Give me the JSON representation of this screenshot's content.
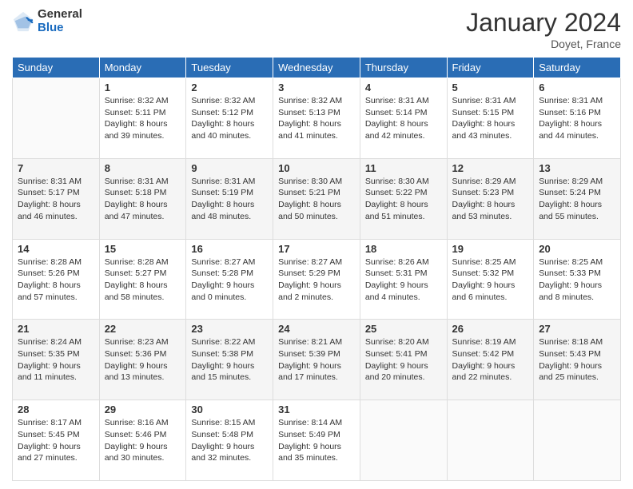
{
  "header": {
    "logo_general": "General",
    "logo_blue": "Blue",
    "month_title": "January 2024",
    "location": "Doyet, France"
  },
  "days_of_week": [
    "Sunday",
    "Monday",
    "Tuesday",
    "Wednesday",
    "Thursday",
    "Friday",
    "Saturday"
  ],
  "weeks": [
    [
      {
        "day": "",
        "sunrise": "",
        "sunset": "",
        "daylight": ""
      },
      {
        "day": "1",
        "sunrise": "Sunrise: 8:32 AM",
        "sunset": "Sunset: 5:11 PM",
        "daylight": "Daylight: 8 hours and 39 minutes."
      },
      {
        "day": "2",
        "sunrise": "Sunrise: 8:32 AM",
        "sunset": "Sunset: 5:12 PM",
        "daylight": "Daylight: 8 hours and 40 minutes."
      },
      {
        "day": "3",
        "sunrise": "Sunrise: 8:32 AM",
        "sunset": "Sunset: 5:13 PM",
        "daylight": "Daylight: 8 hours and 41 minutes."
      },
      {
        "day": "4",
        "sunrise": "Sunrise: 8:31 AM",
        "sunset": "Sunset: 5:14 PM",
        "daylight": "Daylight: 8 hours and 42 minutes."
      },
      {
        "day": "5",
        "sunrise": "Sunrise: 8:31 AM",
        "sunset": "Sunset: 5:15 PM",
        "daylight": "Daylight: 8 hours and 43 minutes."
      },
      {
        "day": "6",
        "sunrise": "Sunrise: 8:31 AM",
        "sunset": "Sunset: 5:16 PM",
        "daylight": "Daylight: 8 hours and 44 minutes."
      }
    ],
    [
      {
        "day": "7",
        "sunrise": "Sunrise: 8:31 AM",
        "sunset": "Sunset: 5:17 PM",
        "daylight": "Daylight: 8 hours and 46 minutes."
      },
      {
        "day": "8",
        "sunrise": "Sunrise: 8:31 AM",
        "sunset": "Sunset: 5:18 PM",
        "daylight": "Daylight: 8 hours and 47 minutes."
      },
      {
        "day": "9",
        "sunrise": "Sunrise: 8:31 AM",
        "sunset": "Sunset: 5:19 PM",
        "daylight": "Daylight: 8 hours and 48 minutes."
      },
      {
        "day": "10",
        "sunrise": "Sunrise: 8:30 AM",
        "sunset": "Sunset: 5:21 PM",
        "daylight": "Daylight: 8 hours and 50 minutes."
      },
      {
        "day": "11",
        "sunrise": "Sunrise: 8:30 AM",
        "sunset": "Sunset: 5:22 PM",
        "daylight": "Daylight: 8 hours and 51 minutes."
      },
      {
        "day": "12",
        "sunrise": "Sunrise: 8:29 AM",
        "sunset": "Sunset: 5:23 PM",
        "daylight": "Daylight: 8 hours and 53 minutes."
      },
      {
        "day": "13",
        "sunrise": "Sunrise: 8:29 AM",
        "sunset": "Sunset: 5:24 PM",
        "daylight": "Daylight: 8 hours and 55 minutes."
      }
    ],
    [
      {
        "day": "14",
        "sunrise": "Sunrise: 8:28 AM",
        "sunset": "Sunset: 5:26 PM",
        "daylight": "Daylight: 8 hours and 57 minutes."
      },
      {
        "day": "15",
        "sunrise": "Sunrise: 8:28 AM",
        "sunset": "Sunset: 5:27 PM",
        "daylight": "Daylight: 8 hours and 58 minutes."
      },
      {
        "day": "16",
        "sunrise": "Sunrise: 8:27 AM",
        "sunset": "Sunset: 5:28 PM",
        "daylight": "Daylight: 9 hours and 0 minutes."
      },
      {
        "day": "17",
        "sunrise": "Sunrise: 8:27 AM",
        "sunset": "Sunset: 5:29 PM",
        "daylight": "Daylight: 9 hours and 2 minutes."
      },
      {
        "day": "18",
        "sunrise": "Sunrise: 8:26 AM",
        "sunset": "Sunset: 5:31 PM",
        "daylight": "Daylight: 9 hours and 4 minutes."
      },
      {
        "day": "19",
        "sunrise": "Sunrise: 8:25 AM",
        "sunset": "Sunset: 5:32 PM",
        "daylight": "Daylight: 9 hours and 6 minutes."
      },
      {
        "day": "20",
        "sunrise": "Sunrise: 8:25 AM",
        "sunset": "Sunset: 5:33 PM",
        "daylight": "Daylight: 9 hours and 8 minutes."
      }
    ],
    [
      {
        "day": "21",
        "sunrise": "Sunrise: 8:24 AM",
        "sunset": "Sunset: 5:35 PM",
        "daylight": "Daylight: 9 hours and 11 minutes."
      },
      {
        "day": "22",
        "sunrise": "Sunrise: 8:23 AM",
        "sunset": "Sunset: 5:36 PM",
        "daylight": "Daylight: 9 hours and 13 minutes."
      },
      {
        "day": "23",
        "sunrise": "Sunrise: 8:22 AM",
        "sunset": "Sunset: 5:38 PM",
        "daylight": "Daylight: 9 hours and 15 minutes."
      },
      {
        "day": "24",
        "sunrise": "Sunrise: 8:21 AM",
        "sunset": "Sunset: 5:39 PM",
        "daylight": "Daylight: 9 hours and 17 minutes."
      },
      {
        "day": "25",
        "sunrise": "Sunrise: 8:20 AM",
        "sunset": "Sunset: 5:41 PM",
        "daylight": "Daylight: 9 hours and 20 minutes."
      },
      {
        "day": "26",
        "sunrise": "Sunrise: 8:19 AM",
        "sunset": "Sunset: 5:42 PM",
        "daylight": "Daylight: 9 hours and 22 minutes."
      },
      {
        "day": "27",
        "sunrise": "Sunrise: 8:18 AM",
        "sunset": "Sunset: 5:43 PM",
        "daylight": "Daylight: 9 hours and 25 minutes."
      }
    ],
    [
      {
        "day": "28",
        "sunrise": "Sunrise: 8:17 AM",
        "sunset": "Sunset: 5:45 PM",
        "daylight": "Daylight: 9 hours and 27 minutes."
      },
      {
        "day": "29",
        "sunrise": "Sunrise: 8:16 AM",
        "sunset": "Sunset: 5:46 PM",
        "daylight": "Daylight: 9 hours and 30 minutes."
      },
      {
        "day": "30",
        "sunrise": "Sunrise: 8:15 AM",
        "sunset": "Sunset: 5:48 PM",
        "daylight": "Daylight: 9 hours and 32 minutes."
      },
      {
        "day": "31",
        "sunrise": "Sunrise: 8:14 AM",
        "sunset": "Sunset: 5:49 PM",
        "daylight": "Daylight: 9 hours and 35 minutes."
      },
      {
        "day": "",
        "sunrise": "",
        "sunset": "",
        "daylight": ""
      },
      {
        "day": "",
        "sunrise": "",
        "sunset": "",
        "daylight": ""
      },
      {
        "day": "",
        "sunrise": "",
        "sunset": "",
        "daylight": ""
      }
    ]
  ]
}
